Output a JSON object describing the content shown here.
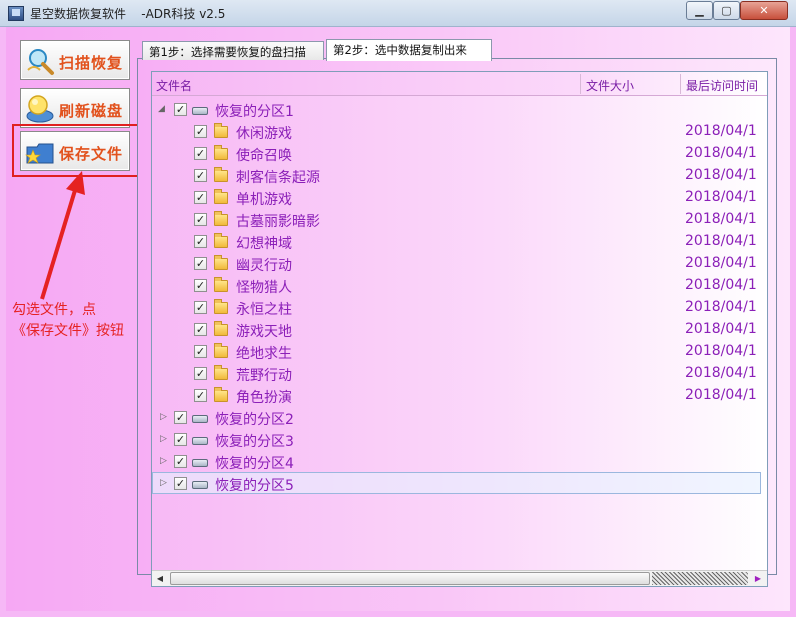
{
  "window": {
    "title": "星空数据恢复软件    -ADR科技 v2.5",
    "min_symbol": "▁",
    "max_symbol": "▢",
    "close_symbol": "✕"
  },
  "sidebar": {
    "scan_label": "扫描恢复",
    "refresh_label": "刷新磁盘",
    "save_label": "保存文件"
  },
  "annotation": {
    "line1": "勾选文件，点",
    "line2": "《保存文件》按钮"
  },
  "tabs": {
    "step1": "第1步：选择需要恢复的盘扫描",
    "step2": "第2步：选中数据复制出来"
  },
  "columns": {
    "name": "文件名",
    "size": "文件大小",
    "atime": "最后访问时间"
  },
  "tree": {
    "partition1": "恢复的分区1",
    "folders": [
      {
        "name": "休闲游戏",
        "date": "2018/04/1"
      },
      {
        "name": "使命召唤",
        "date": "2018/04/1"
      },
      {
        "name": "刺客信条起源",
        "date": "2018/04/1"
      },
      {
        "name": "单机游戏",
        "date": "2018/04/1"
      },
      {
        "name": "古墓丽影暗影",
        "date": "2018/04/1"
      },
      {
        "name": "幻想神域",
        "date": "2018/04/1"
      },
      {
        "name": "幽灵行动",
        "date": "2018/04/1"
      },
      {
        "name": "怪物猎人",
        "date": "2018/04/1"
      },
      {
        "name": "永恒之柱",
        "date": "2018/04/1"
      },
      {
        "name": "游戏天地",
        "date": "2018/04/1"
      },
      {
        "name": "绝地求生",
        "date": "2018/04/1"
      },
      {
        "name": "荒野行动",
        "date": "2018/04/1"
      },
      {
        "name": "角色扮演",
        "date": "2018/04/1"
      }
    ],
    "partition2": "恢复的分区2",
    "partition3": "恢复的分区3",
    "partition4": "恢复的分区4",
    "partition5": "恢复的分区5"
  },
  "colors": {
    "accent_text": "#8b1fb8",
    "button_text": "#e2521d",
    "annotation": "#e52222"
  }
}
